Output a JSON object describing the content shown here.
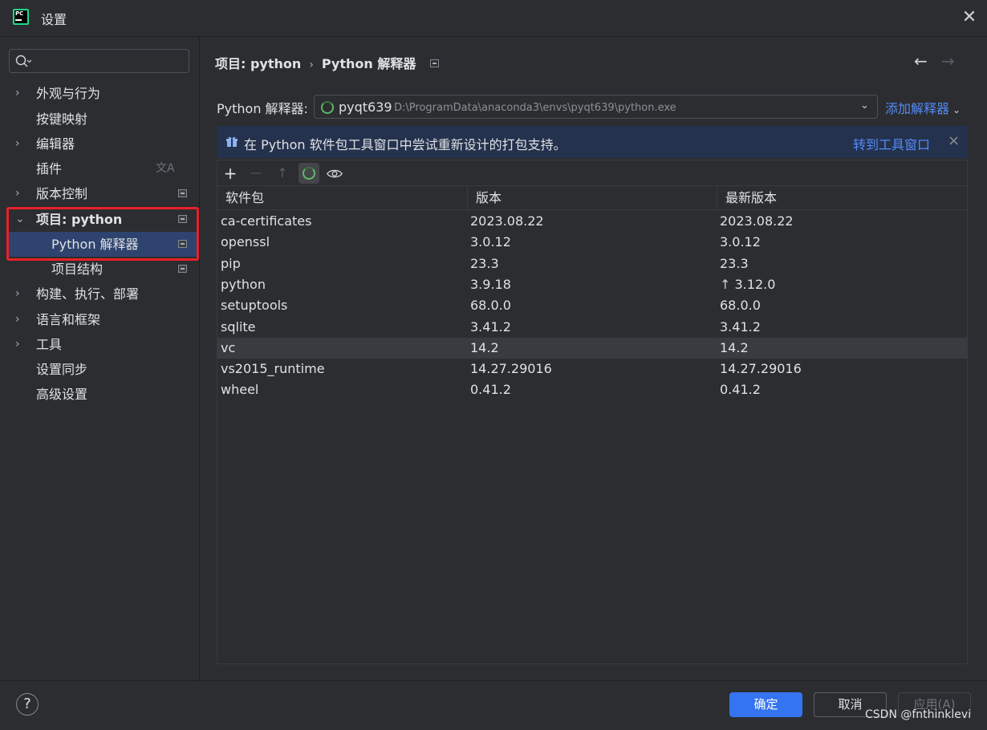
{
  "window": {
    "title": "设置",
    "close_icon": "close-icon",
    "logo_text": "PC"
  },
  "sidebar": {
    "search_placeholder": "",
    "items": [
      {
        "label": "外观与行为",
        "expandable": true
      },
      {
        "label": "按键映射",
        "expandable": false
      },
      {
        "label": "编辑器",
        "expandable": true
      },
      {
        "label": "插件",
        "expandable": false,
        "trailing_icon": "translate-icon"
      },
      {
        "label": "版本控制",
        "expandable": true,
        "trailing_icon": "project-scope-icon"
      },
      {
        "label": "项目: python",
        "expanded": true,
        "trailing_icon": "project-scope-icon"
      },
      {
        "label": "Python 解释器",
        "selected": true,
        "trailing_icon": "project-scope-icon"
      },
      {
        "label": "项目结构",
        "trailing_icon": "project-scope-icon"
      },
      {
        "label": "构建、执行、部署",
        "expandable": true
      },
      {
        "label": "语言和框架",
        "expandable": true
      },
      {
        "label": "工具",
        "expandable": true
      },
      {
        "label": "设置同步",
        "expandable": false
      },
      {
        "label": "高级设置",
        "expandable": false
      }
    ],
    "chevron_collapsed": "›",
    "chevron_expanded": "⌄",
    "translate_glyph": "文A"
  },
  "breadcrumb": {
    "parent": "项目: python",
    "separator": "›",
    "current": "Python 解释器"
  },
  "interpreter": {
    "label": "Python 解释器:",
    "name": "pyqt639",
    "path": "D:\\ProgramData\\anaconda3\\envs\\pyqt639\\python.exe",
    "add_label": "添加解释器"
  },
  "banner": {
    "text": "在 Python 软件包工具窗口中尝试重新设计的打包支持。",
    "link": "转到工具窗口",
    "close": "×"
  },
  "toolbar": {
    "add": "+",
    "remove": "—",
    "upgrade": "↑",
    "show": "◉"
  },
  "table": {
    "columns": [
      "软件包",
      "版本",
      "最新版本"
    ],
    "rows": [
      {
        "package": "ca-certificates",
        "version": "2023.08.22",
        "latest": "2023.08.22",
        "upgrade": false
      },
      {
        "package": "openssl",
        "version": "3.0.12",
        "latest": "3.0.12",
        "upgrade": false
      },
      {
        "package": "pip",
        "version": "23.3",
        "latest": "23.3",
        "upgrade": false
      },
      {
        "package": "python",
        "version": "3.9.18",
        "latest": "3.12.0",
        "upgrade": true
      },
      {
        "package": "setuptools",
        "version": "68.0.0",
        "latest": "68.0.0",
        "upgrade": false
      },
      {
        "package": "sqlite",
        "version": "3.41.2",
        "latest": "3.41.2",
        "upgrade": false
      },
      {
        "package": "vc",
        "version": "14.2",
        "latest": "14.2",
        "upgrade": false,
        "hover": true
      },
      {
        "package": "vs2015_runtime",
        "version": "14.27.29016",
        "latest": "14.27.29016",
        "upgrade": false
      },
      {
        "package": "wheel",
        "version": "0.41.2",
        "latest": "0.41.2",
        "upgrade": false
      }
    ]
  },
  "footer": {
    "help": "?",
    "ok": "确定",
    "cancel": "取消",
    "apply": "应用(A)"
  },
  "watermark": "CSDN @fnthinklevi",
  "colors": {
    "background": "#2b2d30",
    "selection": "#2e436e",
    "accent": "#3574f0",
    "link": "#548af7",
    "highlight_box": "#e8202a",
    "banner": "#25324d"
  }
}
